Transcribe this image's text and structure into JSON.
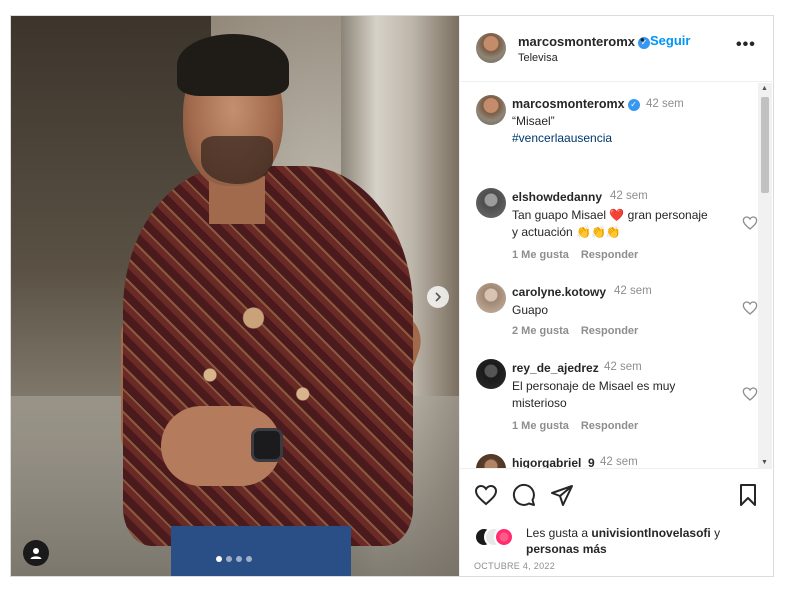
{
  "post": {
    "carousel": {
      "slides": 4,
      "current_slide": 1
    }
  },
  "header": {
    "username": "marcosmonteromx",
    "separator": "•",
    "follow_label": "Seguir",
    "location": "Televisa",
    "more_label": "•••"
  },
  "caption": {
    "username": "marcosmonteromx",
    "time": "42 sem",
    "text": "“Misael”",
    "hashtag": "#vencerlaausencia"
  },
  "comments": [
    {
      "username": "elshowdedanny",
      "time": "42 sem",
      "text": "Tan guapo Misael ❤️ gran personaje y actuación 👏👏👏",
      "likes": "1 Me gusta",
      "reply": "Responder"
    },
    {
      "username": "carolyne.kotowy",
      "time": "42 sem",
      "text": "Guapo",
      "likes": "2 Me gusta",
      "reply": "Responder"
    },
    {
      "username": "rey_de_ajedrez",
      "time": "42 sem",
      "text": "El personaje de Misael es muy misterioso",
      "likes": "1 Me gusta",
      "reply": "Responder"
    },
    {
      "username": "higorgabriel_9",
      "time": "42 sem"
    }
  ],
  "likes": {
    "prefix": "Les gusta a ",
    "user": "univisiontlnovelasofi",
    "middle": " y",
    "rest": "personas más"
  },
  "date": "OCTUBRE 4, 2022",
  "colors": {
    "accent": "#0095f6",
    "verified": "#3897f0",
    "heart_red": "#ed4956"
  },
  "icons": [
    "heart-icon",
    "comment-icon",
    "share-icon",
    "bookmark-icon",
    "verified-badge-icon",
    "more-icon",
    "chevron-right-icon",
    "tag-user-icon"
  ]
}
